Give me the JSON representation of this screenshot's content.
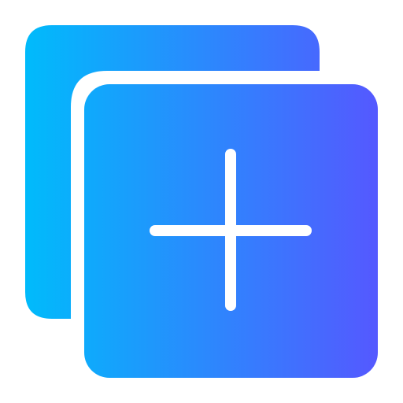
{
  "icon": {
    "name": "add-copy-icon",
    "gradient_start": "#00bbfb",
    "gradient_end": "#5558ff",
    "background": "#ffffff",
    "plus_color": "#ffffff"
  }
}
